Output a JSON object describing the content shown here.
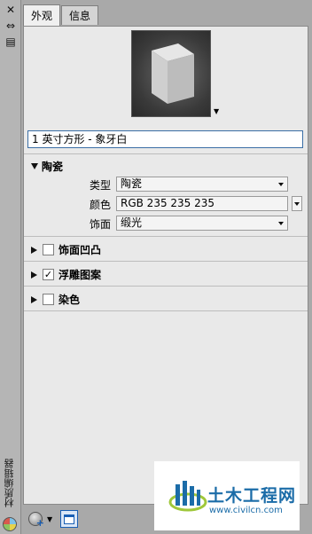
{
  "sidebar": {
    "close_glyph": "✕",
    "autohide_glyph": "⇔",
    "properties_glyph": "▤",
    "title": "材质编辑器"
  },
  "tabs": [
    {
      "label": "外观",
      "active": true
    },
    {
      "label": "信息",
      "active": false
    }
  ],
  "material": {
    "name": "1 英寸方形 - 象牙白",
    "preview_dropdown_glyph": "▼"
  },
  "sections": {
    "ceramic": {
      "title": "陶瓷",
      "expanded": true,
      "props": {
        "type_label": "类型",
        "type_value": "陶瓷",
        "color_label": "颜色",
        "color_value": "RGB 235 235 235",
        "finish_label": "饰面",
        "finish_value": "缎光"
      }
    },
    "finish_bumps": {
      "title": "饰面凹凸",
      "checked": false
    },
    "relief_pattern": {
      "title": "浮雕图案",
      "checked": true,
      "check_glyph": "✓"
    },
    "tint": {
      "title": "染色",
      "checked": false
    }
  },
  "bottombar": {
    "create_dropdown_glyph": "▼",
    "create_plus_glyph": "+"
  },
  "watermark": {
    "title": "土木工程网",
    "url": "www.civilcn.com"
  },
  "colors": {
    "panel_bg": "#e9e9e9",
    "outer_bg": "#a9a9a9",
    "accent": "#1a5fb4",
    "watermark_blue": "#1b6ca8"
  }
}
